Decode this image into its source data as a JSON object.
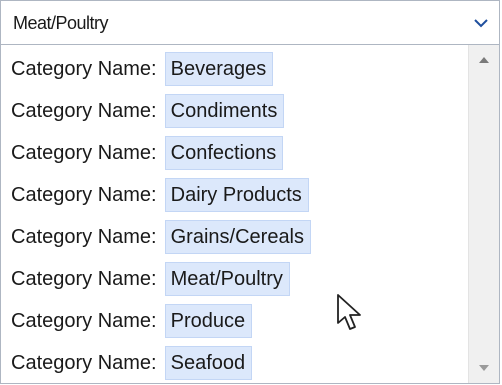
{
  "combo": {
    "selected": "Meat/Poultry",
    "arrow_icon": "chevron-down-icon"
  },
  "list": {
    "items": [
      {
        "label": "Category Name:",
        "value": "Beverages"
      },
      {
        "label": "Category Name:",
        "value": "Condiments"
      },
      {
        "label": "Category Name:",
        "value": "Confections"
      },
      {
        "label": "Category Name:",
        "value": "Dairy Products"
      },
      {
        "label": "Category Name:",
        "value": "Grains/Cereals"
      },
      {
        "label": "Category Name:",
        "value": "Meat/Poultry"
      },
      {
        "label": "Category Name:",
        "value": "Produce"
      },
      {
        "label": "Category Name:",
        "value": "Seafood"
      }
    ]
  },
  "scrollbar": {
    "up_icon": "scroll-up-arrow-icon",
    "down_icon": "scroll-down-arrow-icon"
  },
  "colors": {
    "item_highlight": "#dce8fb",
    "border": "#aeb6c2",
    "scrollbar_bg": "#f0f0f0"
  }
}
